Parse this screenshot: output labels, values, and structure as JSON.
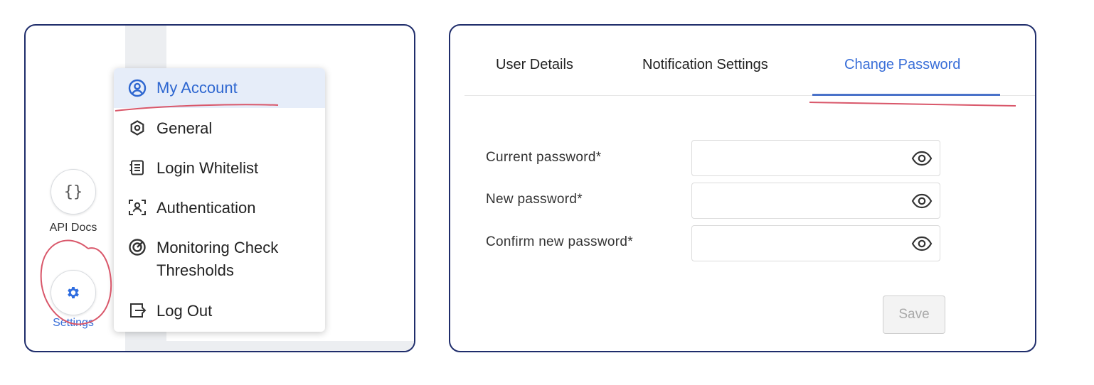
{
  "left": {
    "nav": {
      "api_docs": {
        "label": "API Docs",
        "icon": "braces-icon"
      },
      "settings": {
        "label": "Settings",
        "icon": "gear-icon"
      }
    },
    "dropdown": {
      "items": [
        {
          "label": "My Account",
          "icon": "user-circle-icon",
          "active": true
        },
        {
          "label": "General",
          "icon": "hexagon-icon"
        },
        {
          "label": "Login Whitelist",
          "icon": "list-icon"
        },
        {
          "label": "Authentication",
          "icon": "face-scan-icon"
        },
        {
          "label": "Monitoring Check",
          "label_line2": "Thresholds",
          "icon": "target-icon"
        },
        {
          "label": "Log Out",
          "icon": "logout-icon"
        }
      ]
    }
  },
  "right": {
    "tabs": [
      {
        "label": "User Details"
      },
      {
        "label": "Notification Settings"
      },
      {
        "label": "Change Password",
        "active": true
      }
    ],
    "form": {
      "current_label": "Current password*",
      "new_label": "New password*",
      "confirm_label": "Confirm new password*",
      "save_label": "Save"
    }
  },
  "colors": {
    "accent": "#3a6fd8",
    "panel_border": "#1f2d6b",
    "annotation": "#d9576a",
    "active_bg": "#e6edf9"
  }
}
